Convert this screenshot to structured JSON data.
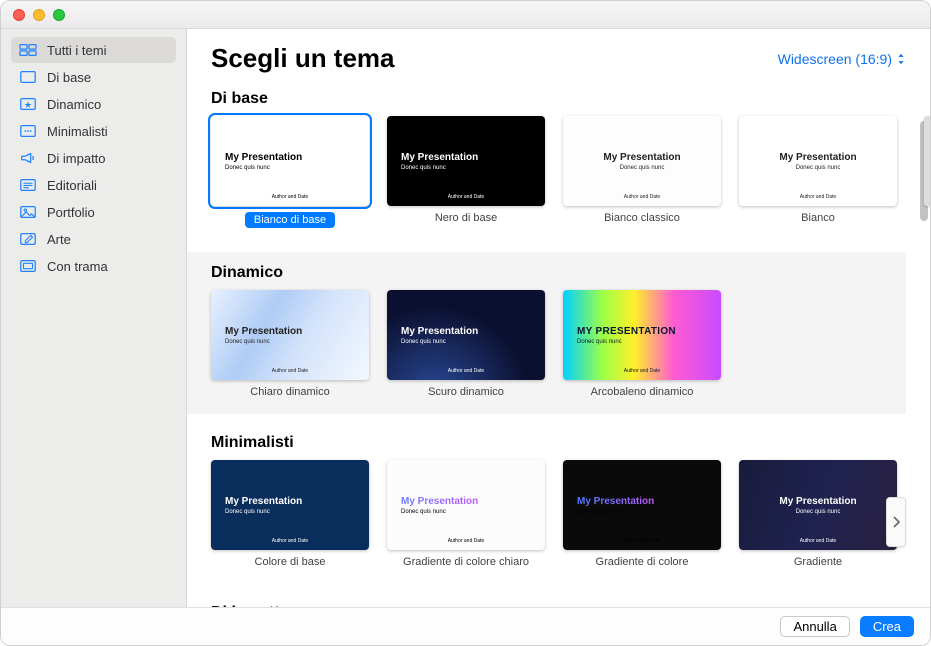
{
  "header": {
    "title": "Scegli un tema",
    "aspect_label": "Widescreen (16:9)"
  },
  "sidebar": {
    "items": [
      {
        "label": "Tutti i temi",
        "icon": "grid-2x2"
      },
      {
        "label": "Di base",
        "icon": "square"
      },
      {
        "label": "Dinamico",
        "icon": "sparkle"
      },
      {
        "label": "Minimalisti",
        "icon": "dots"
      },
      {
        "label": "Di impatto",
        "icon": "megaphone"
      },
      {
        "label": "Editoriali",
        "icon": "lines"
      },
      {
        "label": "Portfolio",
        "icon": "photo"
      },
      {
        "label": "Arte",
        "icon": "brush"
      },
      {
        "label": "Con trama",
        "icon": "frame"
      }
    ],
    "selected_index": 0
  },
  "preview_text": {
    "title": "My Presentation",
    "subtitle": "Donec quis nunc",
    "footer": "Author and Date",
    "title_upper": "MY PRESENTATION"
  },
  "sections": [
    {
      "title": "Di base",
      "themes": [
        {
          "label": "Bianco di base",
          "style": "bg-white",
          "selected": true
        },
        {
          "label": "Nero di base",
          "style": "bg-black"
        },
        {
          "label": "Bianco classico",
          "style": "bg-classic",
          "center": true
        },
        {
          "label": "Bianco",
          "style": "bg-bianco",
          "center": true
        }
      ],
      "scroll_peek": true
    },
    {
      "title": "Dinamico",
      "alt": true,
      "themes": [
        {
          "label": "Chiaro dinamico",
          "style": "bg-chiaro"
        },
        {
          "label": "Scuro dinamico",
          "style": "bg-scuro"
        },
        {
          "label": "Arcobaleno dinamico",
          "style": "bg-arco",
          "title_variant": "upper"
        }
      ]
    },
    {
      "title": "Minimalisti",
      "themes": [
        {
          "label": "Colore di base",
          "style": "bg-colore"
        },
        {
          "label": "Gradiente di colore chiaro",
          "style": "bg-grad-chiaro",
          "title_variant": "grad"
        },
        {
          "label": "Gradiente di colore",
          "style": "bg-grad-col",
          "title_variant": "grad-dark"
        },
        {
          "label": "Gradiente",
          "style": "bg-grad",
          "center": true
        }
      ],
      "next_arrow": true
    }
  ],
  "cutoff_section_title": "Di impatto",
  "buttons": {
    "cancel": "Annulla",
    "create": "Crea"
  },
  "colors": {
    "accent": "#007aff"
  }
}
